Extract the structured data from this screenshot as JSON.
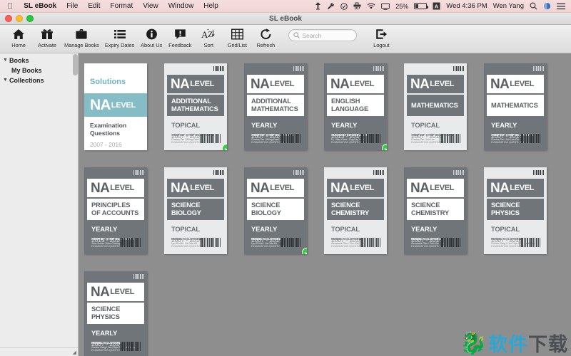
{
  "menubar": {
    "apple": "apple-logo",
    "app_name": "SL eBook",
    "items": [
      "File",
      "Edit",
      "Format",
      "View",
      "Window",
      "Help"
    ],
    "status": {
      "battery_percent": "25%",
      "clock": "Wed 4:36 PM",
      "user": "Wen Yang",
      "icons": [
        "airplay-icon",
        "wrench-icon",
        "checkbox-icon",
        "shredder-icon",
        "wifi-icon",
        "screen-icon",
        "battery-icon",
        "input-source-icon",
        "search-icon",
        "notification-icon",
        "control-center-icon"
      ]
    }
  },
  "window": {
    "title": "SL eBook"
  },
  "toolbar": {
    "buttons": [
      {
        "label": "Home",
        "icon": "home-icon"
      },
      {
        "label": "Activate",
        "icon": "gift-icon"
      },
      {
        "label": "Manage Books",
        "icon": "briefcase-icon"
      },
      {
        "label": "Expiry Dates",
        "icon": "list-icon"
      },
      {
        "label": "About Us",
        "icon": "info-icon"
      },
      {
        "label": "Feedback",
        "icon": "comment-icon"
      },
      {
        "label": "Sort",
        "icon": "sort-az-icon"
      },
      {
        "label": "Grid/List",
        "icon": "grid-icon"
      },
      {
        "label": "Refresh",
        "icon": "refresh-icon"
      }
    ],
    "search_placeholder": "Search",
    "logout": {
      "label": "Logout",
      "icon": "logout-icon"
    }
  },
  "sidebar": {
    "items": [
      {
        "label": "Books",
        "level": 0,
        "expanded": true
      },
      {
        "label": "My Books",
        "level": 1,
        "expanded": false
      },
      {
        "label": "Collections",
        "level": 0,
        "expanded": true
      }
    ]
  },
  "colors": {
    "accent_teal": "#86bcc6",
    "book_gray": "#70757a",
    "book_light": "#e9eaeb",
    "badge_green": "#2fcf3d",
    "canvas": "#8e8e8e"
  },
  "books": [
    {
      "style": "solutions",
      "solutions_label": "Solutions",
      "na": "NA",
      "level": "LEVEL",
      "title_line1": "Examination",
      "title_line2": "Questions",
      "years": "2007 - 2016",
      "owned": false
    },
    {
      "style": "light-cover",
      "na": "NA",
      "level": "LEVEL",
      "subject_line1": "ADDITIONAL",
      "subject_line2": "MATHEMATICS",
      "type": "TOPICAL",
      "solutions": "STEP-BY-STEP SOLUTIONS",
      "author": "Charles Tan / Wong Keat Ling",
      "years": "2007 - 2016",
      "exam": "EXAMINATION QUESTIONS",
      "owned": true
    },
    {
      "style": "dark-cover",
      "na": "NA",
      "level": "LEVEL",
      "subject_line1": "ADDITIONAL",
      "subject_line2": "MATHEMATICS",
      "type": "YEARLY",
      "solutions": "STEP-BY-STEP SOLUTIONS",
      "author": "Charles Tan / Wong Keat Ling",
      "years": "2007 - 2016",
      "exam": "EXAMINATION QUESTIONS",
      "owned": false
    },
    {
      "style": "dark-cover",
      "na": "NA",
      "level": "LEVEL",
      "subject_line1": "ENGLISH",
      "subject_line2": "LANGUAGE",
      "type": "YEARLY",
      "solutions": "SUGGESTED ANSWERS",
      "author": "Dr. Lilian Chee / Ong Lay Hoon",
      "years": "2013 - 2016",
      "exam": "EXAMINATION QUESTIONS",
      "owned": true
    },
    {
      "style": "light-cover",
      "na": "NA",
      "level": "LEVEL",
      "subject_line1": "MATHEMATICS",
      "subject_line2": "",
      "type": "TOPICAL",
      "solutions": "STEP-BY-STEP SOLUTIONS",
      "author": "Charles Tan / Lim Lee",
      "years": "2007 - 2016",
      "exam": "EXAMINATION QUESTIONS",
      "owned": false
    },
    {
      "style": "dark-cover",
      "na": "NA",
      "level": "LEVEL",
      "subject_line1": "MATHEMATICS",
      "subject_line2": "",
      "type": "YEARLY",
      "solutions": "STEP-BY-STEP SOLUTIONS",
      "author": "Charles Tan / Lim Lee Kim",
      "years": "2007 - 2016",
      "exam": "EXAMINATION QUESTIONS",
      "owned": false
    },
    {
      "style": "dark-cover",
      "na": "NA",
      "level": "LEVEL",
      "subject_line1": "PRINCIPLES",
      "subject_line2": "OF ACCOUNTS",
      "type": "YEARLY",
      "solutions": "STEP-BY-STEP SOLUTIONS",
      "author": "John Sneak / Mun Cheong",
      "years": "2015 - 2016",
      "exam": "EXAMINATION QUESTIONS",
      "owned": false
    },
    {
      "style": "light-cover",
      "na": "NA",
      "level": "LEVEL",
      "subject_line1": "SCIENCE",
      "subject_line2": "BIOLOGY",
      "type": "TOPICAL",
      "solutions": "MODEL SOLUTIONS",
      "author": "Lye Ai Kiat / Loh Wai Kit",
      "years": "2007 - 2016",
      "exam": "EXAMINATION QUESTIONS",
      "owned": false
    },
    {
      "style": "dark-cover",
      "na": "NA",
      "level": "LEVEL",
      "subject_line1": "SCIENCE",
      "subject_line2": "BIOLOGY",
      "type": "YEARLY",
      "solutions": "MODEL SOLUTIONS",
      "author": "Lye Ai Kiat / Loh Wai Kit",
      "years": "2007 - 2016",
      "exam": "EXAMINATION QUESTIONS",
      "owned": true
    },
    {
      "style": "light-cover",
      "na": "NA",
      "level": "LEVEL",
      "subject_line1": "SCIENCE",
      "subject_line2": "CHEMISTRY",
      "type": "TOPICAL",
      "solutions": "MODEL SOLUTIONS",
      "author": "Alexandra Chin / Goh Kim Lee",
      "years": "2007 - 2016",
      "exam": "EXAMINATION QUESTIONS",
      "owned": false
    },
    {
      "style": "dark-cover",
      "na": "NA",
      "level": "LEVEL",
      "subject_line1": "SCIENCE",
      "subject_line2": "CHEMISTRY",
      "type": "YEARLY",
      "solutions": "MODEL SOLUTIONS",
      "author": "Alexandra Chin / Goh Kim Lee",
      "years": "2007 - 2016",
      "exam": "EXAMINATION QUESTIONS",
      "owned": false
    },
    {
      "style": "light-cover",
      "na": "NA",
      "level": "LEVEL",
      "subject_line1": "SCIENCE",
      "subject_line2": "PHYSICS",
      "type": "TOPICAL",
      "solutions": "MODEL SOLUTIONS",
      "author": "Gordon Kang / Lim Chye Wah Lantsbury",
      "years": "2007 - 2016",
      "exam": "EXAMINATION QUESTIONS",
      "owned": false
    },
    {
      "style": "dark-cover",
      "na": "NA",
      "level": "LEVEL",
      "subject_line1": "SCIENCE",
      "subject_line2": "PHYSICS",
      "type": "YEARLY",
      "solutions": "MODEL SOLUTIONS",
      "author": "Gordon Kang / Lim Chye Wah Lantsbury",
      "years": "2007 - 2016",
      "exam": "EXAMINATION QUESTIONS",
      "owned": false
    }
  ],
  "watermark": {
    "dragon": "dragon-logo",
    "text_blue": "软件",
    "text_dark": "下载"
  }
}
